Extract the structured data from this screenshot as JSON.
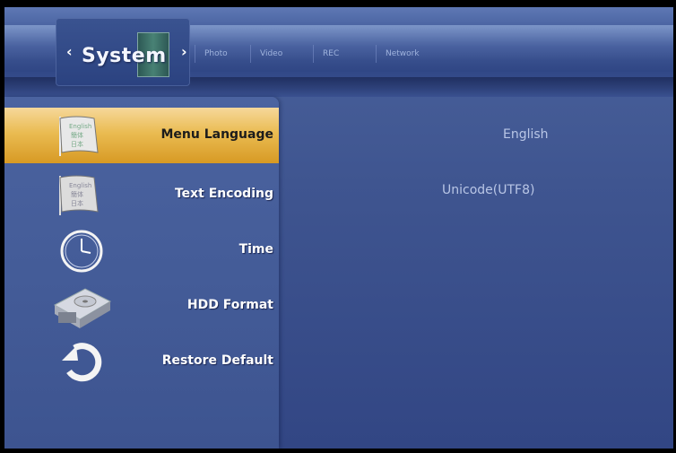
{
  "header": {
    "current_section": "System",
    "tabs": [
      "Photo",
      "Video",
      "REC",
      "Network"
    ]
  },
  "menu": {
    "items": [
      {
        "label": "Menu Language",
        "icon": "language-flag-icon",
        "selected": true
      },
      {
        "label": "Text Encoding",
        "icon": "encoding-flag-icon",
        "selected": false
      },
      {
        "label": "Time",
        "icon": "clock-icon",
        "selected": false
      },
      {
        "label": "HDD Format",
        "icon": "hdd-icon",
        "selected": false
      },
      {
        "label": "Restore Default",
        "icon": "restore-arrow-icon",
        "selected": false
      }
    ]
  },
  "values": {
    "menu_language": "English",
    "text_encoding": "Unicode(UTF8)"
  },
  "icon_text": {
    "lang_flag_lines": [
      "English",
      "簡体",
      "日本"
    ],
    "enc_flag_lines": [
      "English",
      "簡体",
      "日本"
    ]
  },
  "colors": {
    "highlight": "#eabc52",
    "background": "#3f5590",
    "text": "#ffffff"
  }
}
